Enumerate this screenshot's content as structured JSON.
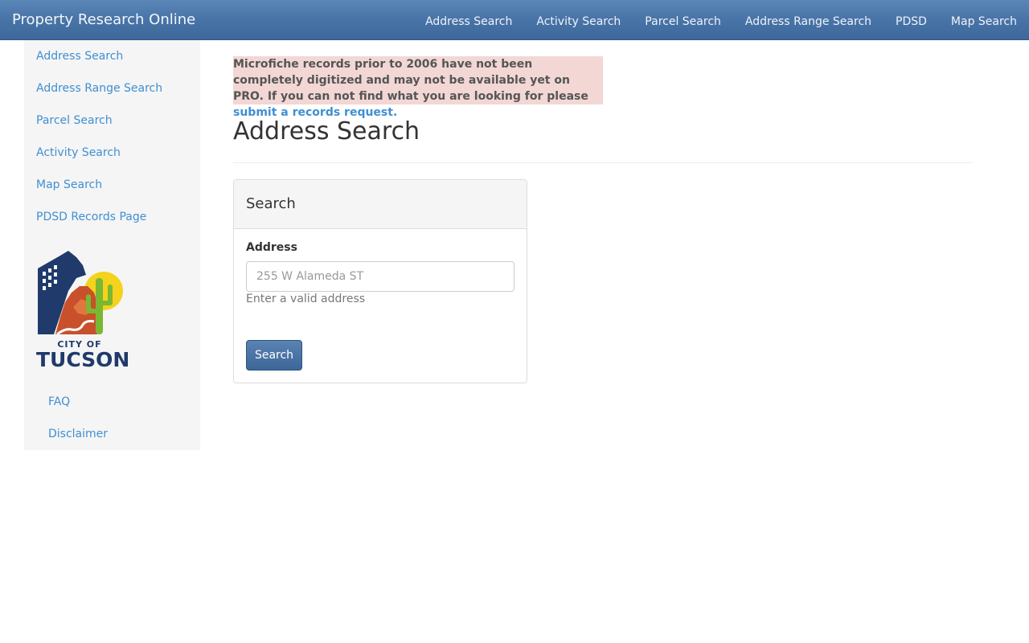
{
  "navbar": {
    "brand": "Property Research Online",
    "links": [
      "Address Search",
      "Activity Search",
      "Parcel Search",
      "Address Range Search",
      "PDSD",
      "Map Search"
    ]
  },
  "sidebar": {
    "links": [
      "Address Search",
      "Address Range Search",
      "Parcel Search",
      "Activity Search",
      "Map Search",
      "PDSD Records Page"
    ],
    "logo": {
      "line1": "CITY OF",
      "line2": "TUCSON"
    },
    "footer_links": [
      "FAQ",
      "Disclaimer"
    ]
  },
  "notice": {
    "text": "Microfiche records prior to 2006 have not been completely digitized and may not be available yet on PRO. If you can not find what you are looking for please ",
    "link": "submit a records request."
  },
  "main": {
    "title": "Address Search",
    "panel": {
      "title": "Search",
      "field_label": "Address",
      "placeholder": "255 W Alameda ST",
      "help": "Enter a valid address",
      "button": "Search"
    }
  },
  "colors": {
    "navbar": "#4a75a8",
    "link": "#3f8fd2",
    "notice_bg": "#f2d7d5",
    "button": "#3c6798"
  },
  "icons": [
    "city-of-tucson-logo"
  ]
}
